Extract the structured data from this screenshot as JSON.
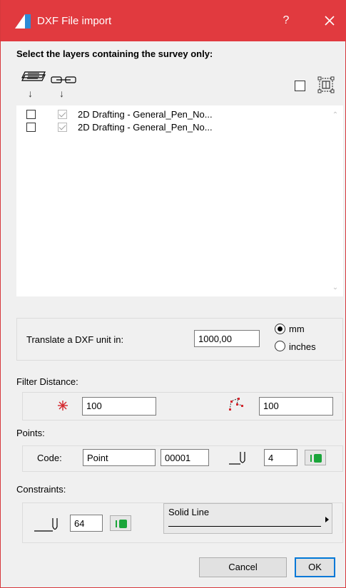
{
  "window": {
    "title": "DXF File import",
    "help_label": "?",
    "accent_color": "#e13a3f"
  },
  "heading": "Select the layers containing the survey only:",
  "toolbar": {
    "survey_icon": "layers-stack-icon",
    "link_icon": "chain-link-icon",
    "select_all_checked": false,
    "zoom_icon": "selection-frame-icon"
  },
  "layers": [
    {
      "selected": false,
      "visible": true,
      "name": "2D Drafting - General_Pen_No..."
    },
    {
      "selected": false,
      "visible": true,
      "name": "2D Drafting - General_Pen_No..."
    }
  ],
  "translate": {
    "label": "Translate a DXF unit in:",
    "value": "1000,00",
    "options": [
      "mm",
      "inches"
    ],
    "selected": "mm"
  },
  "filter": {
    "label": "Filter Distance:",
    "point_value": "100",
    "polygon_value": "100"
  },
  "points": {
    "label": "Points:",
    "code_label": "Code:",
    "code_value": "Point",
    "number_value": "00001",
    "pen_value": "4"
  },
  "constraints": {
    "label": "Constraints:",
    "pen_value": "64",
    "line_type": "Solid Line"
  },
  "buttons": {
    "cancel": "Cancel",
    "ok": "OK"
  }
}
